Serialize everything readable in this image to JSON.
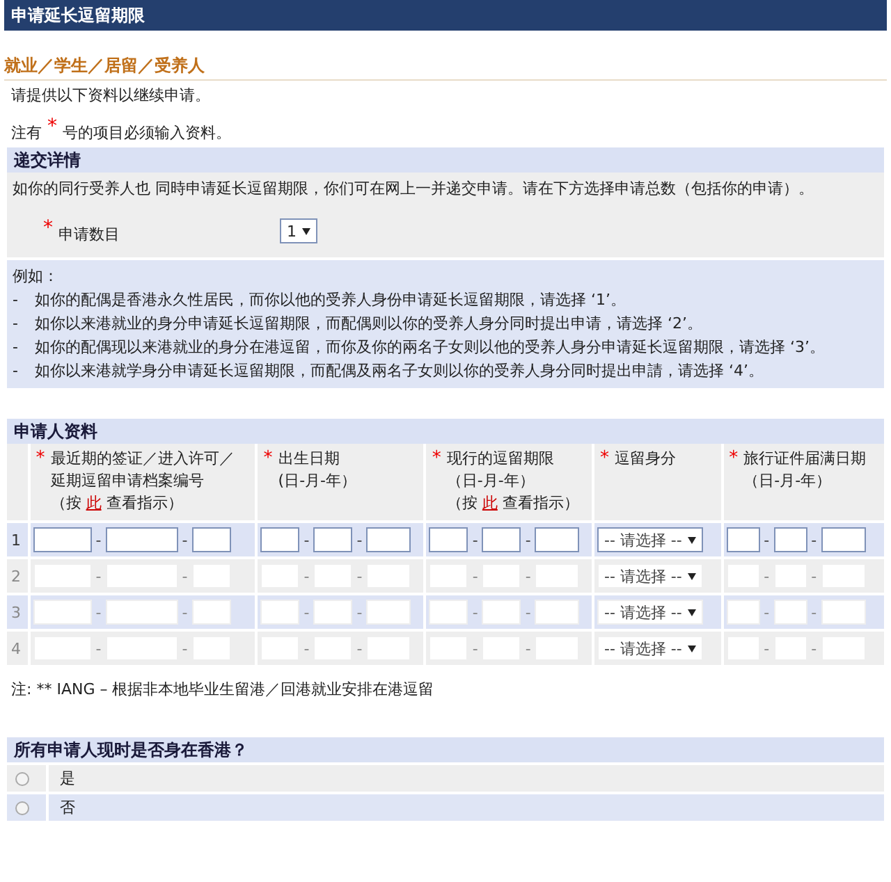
{
  "page_title": "申请延长逗留期限",
  "category": "就业／学生／居留／受养人",
  "intro": "请提供以下资料以继续申请。",
  "required_note": {
    "before": "注有",
    "star": "*",
    "after": "号的项目必须输入资料。"
  },
  "submission": {
    "title": "递交详情",
    "text": "如你的同行受养人也 同時申请延长逗留期限，你们可在网上一并递交申请。请在下方选择申请总数（包括你的申请）。",
    "count_field": {
      "required": true,
      "label": "申请数目",
      "value": "1"
    },
    "examples_title": "例如：",
    "examples": [
      {
        "bullet": "-",
        "text": "如你的配偶是香港永久性居民，而你以他的受养人身份申请延长逗留期限，请选择 ‘1’。"
      },
      {
        "bullet": "-",
        "text": "如你以来港就业的身分申请延长逗留期限，而配偶则以你的受养人身分同时提出申请，请选择 ‘2’。"
      },
      {
        "bullet": "-",
        "text": "如你的配偶现以来港就业的身分在港逗留，而你及你的兩名子女则以他的受养人身分申请延长逗留期限，请选择 ‘3’。"
      },
      {
        "bullet": "-",
        "text": "如你以来港就学身分申请延长逗留期限，而配偶及兩名子女则以你的受养人身分同时提出申請，请选择 ‘4’。"
      }
    ]
  },
  "applicants": {
    "title": "申请人资料",
    "columns": [
      {
        "required": true,
        "lines": [
          "最近期的签证／进入许可／",
          "延期逗留申请档案编号"
        ],
        "hint": {
          "before": "（按",
          "link": "此",
          "after": "查看指示）"
        }
      },
      {
        "required": true,
        "lines": [
          "出生日期",
          "(日-月-年）"
        ]
      },
      {
        "required": true,
        "lines": [
          "现行的逗留期限",
          "（日-月-年）"
        ],
        "hint": {
          "before": "（按",
          "link": "此",
          "after": "查看指示）"
        }
      },
      {
        "required": true,
        "lines": [
          "逗留身分"
        ]
      },
      {
        "required": true,
        "lines": [
          "旅行证件届满日期",
          "（日-月-年）"
        ]
      }
    ],
    "rows": [
      {
        "number": "1",
        "disabled": false,
        "cells": [
          {
            "kind": "parts",
            "separators": [
              "-",
              "-"
            ]
          },
          {
            "kind": "parts",
            "separators": [
              "-",
              "-"
            ]
          },
          {
            "kind": "parts",
            "separators": [
              "-",
              "-"
            ]
          },
          {
            "kind": "select",
            "value": "-- 请选择 --"
          },
          {
            "kind": "parts",
            "separators": [
              "-",
              "-"
            ]
          }
        ]
      },
      {
        "number": "2",
        "disabled": true,
        "cells": [
          {
            "kind": "parts",
            "separators": [
              "-",
              "-"
            ]
          },
          {
            "kind": "parts",
            "separators": [
              "-",
              "-"
            ]
          },
          {
            "kind": "parts",
            "separators": [
              "-",
              "-"
            ]
          },
          {
            "kind": "select",
            "value": "-- 请选择 --"
          },
          {
            "kind": "parts",
            "separators": [
              "-",
              "-"
            ]
          }
        ]
      },
      {
        "number": "3",
        "disabled": true,
        "cells": [
          {
            "kind": "parts",
            "separators": [
              "-",
              "-"
            ]
          },
          {
            "kind": "parts",
            "separators": [
              "-",
              "-"
            ]
          },
          {
            "kind": "parts",
            "separators": [
              "-",
              "-"
            ]
          },
          {
            "kind": "select",
            "value": "-- 请选择 --"
          },
          {
            "kind": "parts",
            "separators": [
              "-",
              "-"
            ]
          }
        ]
      },
      {
        "number": "4",
        "disabled": true,
        "cells": [
          {
            "kind": "parts",
            "separators": [
              "-",
              "-"
            ]
          },
          {
            "kind": "parts",
            "separators": [
              "-",
              "-"
            ]
          },
          {
            "kind": "parts",
            "separators": [
              "-",
              "-"
            ]
          },
          {
            "kind": "select",
            "value": "-- 请选择 --"
          },
          {
            "kind": "parts",
            "separators": [
              "-",
              "-"
            ]
          }
        ]
      }
    ],
    "note": "注: ** IANG – 根据非本地毕业生留港／回港就业安排在港逗留"
  },
  "in_hk": {
    "question": "所有申请人现时是否身在香港？",
    "options": [
      {
        "label": "是",
        "selected": false
      },
      {
        "label": "否",
        "selected": false
      }
    ]
  }
}
